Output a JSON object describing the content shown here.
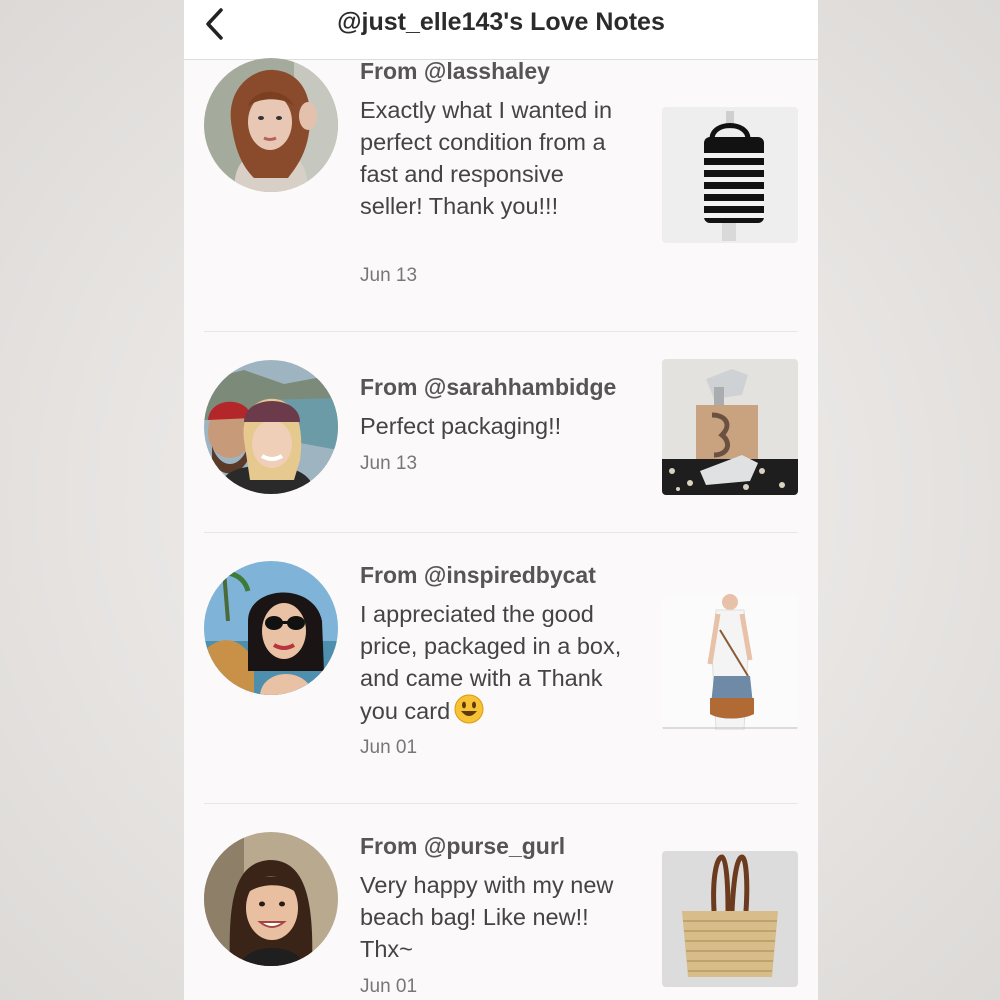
{
  "header": {
    "title": "@just_elle143's Love Notes",
    "back_icon": "chevron-left-icon"
  },
  "notes": [
    {
      "from": "From @lasshaley",
      "text": "Exactly what I wanted in perfect condition from a fast and responsive seller! Thank you!!!",
      "date": "Jun 13",
      "item": "striped backpack"
    },
    {
      "from": "From @sarahhambidge",
      "text": "Perfect packaging!!",
      "date": "Jun 13",
      "item": "silver wedge sandals"
    },
    {
      "from": "From @inspiredbycat",
      "text": "I appreciated the good price, packaged in a box, and came with a Thank you card",
      "emoji": "smiley-emoji-icon",
      "date": "Jun 01",
      "item": "bucket crossbody bag"
    },
    {
      "from": "From @purse_gurl",
      "text": "Very happy with my new beach bag! Like new!! Thx~",
      "date": "Jun 01",
      "item": "straw beach tote"
    }
  ],
  "colors": {
    "header_bg": "#ffffff",
    "list_bg": "#fbf9f9",
    "from_text": "#555555",
    "body_text": "#444444",
    "date_text": "#777777"
  }
}
